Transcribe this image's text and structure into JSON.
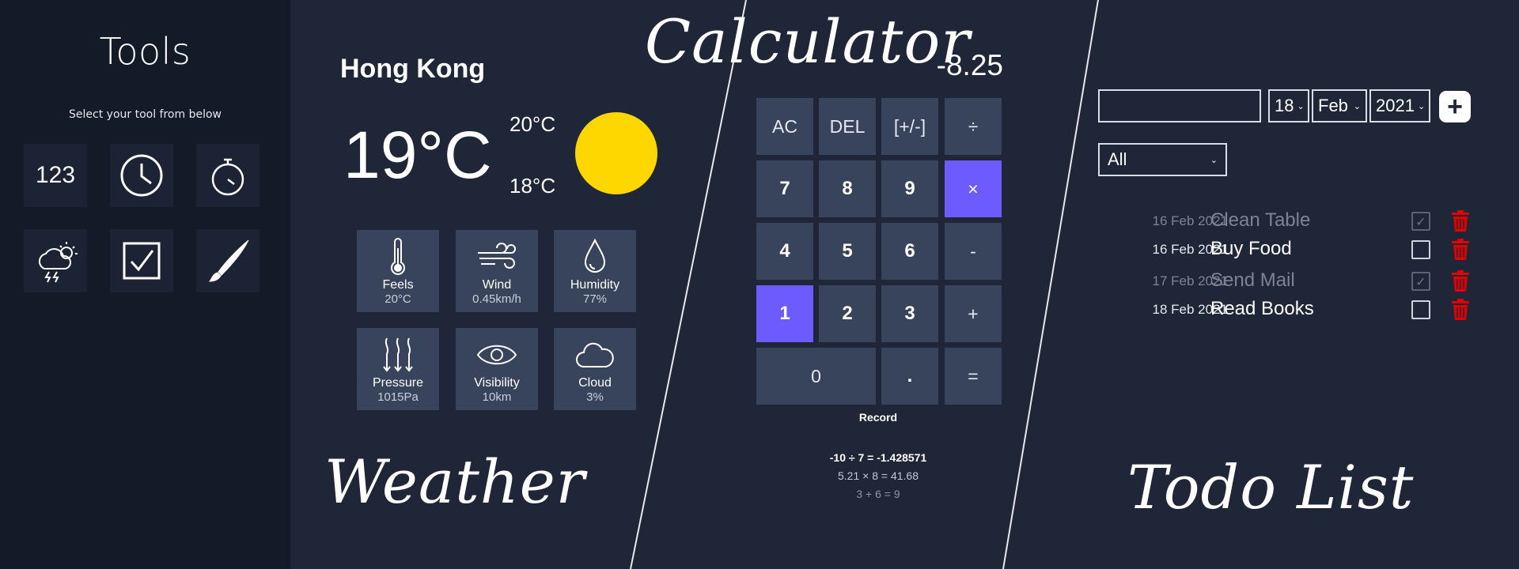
{
  "sidebar": {
    "title": "Tools",
    "subtitle": "Select your tool from below",
    "tools": [
      {
        "name": "calculator",
        "label": "123",
        "icon": "calculator-icon"
      },
      {
        "name": "clock",
        "icon": "clock-icon"
      },
      {
        "name": "stopwatch",
        "icon": "stopwatch-icon"
      },
      {
        "name": "weather",
        "icon": "storm-cloud-icon"
      },
      {
        "name": "todo",
        "icon": "checkbox-icon"
      },
      {
        "name": "paint",
        "icon": "brush-icon"
      }
    ]
  },
  "labels": {
    "weather": "Weather",
    "calculator": "Calculator",
    "todo": "Todo List"
  },
  "weather": {
    "city": "Hong Kong",
    "temp": "19°C",
    "max": "20°C",
    "min": "18°C",
    "condition_icon": "sun-icon",
    "sun_color": "#ffd700",
    "cards": [
      {
        "icon": "thermometer-icon",
        "label": "Feels",
        "value": "20°C"
      },
      {
        "icon": "wind-icon",
        "label": "Wind",
        "value": "0.45km/h"
      },
      {
        "icon": "humidity-icon",
        "label": "Humidity",
        "value": "77%"
      },
      {
        "icon": "pressure-icon",
        "label": "Pressure",
        "value": "1015Pa"
      },
      {
        "icon": "eye-icon",
        "label": "Visibility",
        "value": "10km"
      },
      {
        "icon": "cloud-icon",
        "label": "Cloud",
        "value": "3%"
      }
    ]
  },
  "calculator": {
    "display": "-8.25",
    "keys": {
      "ac": "AC",
      "del": "DEL",
      "neg": "[+/-]",
      "div": "÷",
      "k7": "7",
      "k8": "8",
      "k9": "9",
      "mul": "×",
      "k4": "4",
      "k5": "5",
      "k6": "6",
      "sub": "-",
      "k1": "1",
      "k2": "2",
      "k3": "3",
      "add": "+",
      "k0": "0",
      "dot": ".",
      "eq": "="
    },
    "accent": "#6c5cff",
    "record_title": "Record",
    "records": [
      "-10 ÷ 7 = -1.428571",
      "5.21 × 8 = 41.68",
      "3 + 6 = 9"
    ]
  },
  "todo": {
    "input_value": "",
    "day": "18",
    "month": "Feb",
    "year": "2021",
    "add_label": "+",
    "filter": "All",
    "trash_color": "#e00000",
    "items": [
      {
        "date": "16 Feb 2021",
        "task": "Clean Table",
        "done": true,
        "check": "✓"
      },
      {
        "date": "16 Feb 2021",
        "task": "Buy Food",
        "done": false,
        "check": ""
      },
      {
        "date": "17 Feb 2021",
        "task": "Send Mail",
        "done": true,
        "check": "✓"
      },
      {
        "date": "18 Feb 2021",
        "task": "Read Books",
        "done": false,
        "check": ""
      }
    ]
  }
}
